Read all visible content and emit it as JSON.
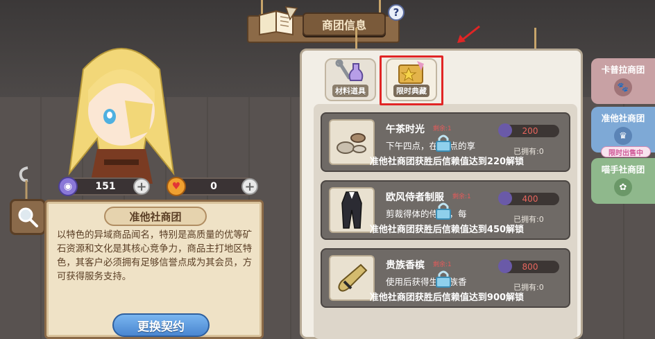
{
  "header": {
    "title": "商团信息",
    "help_label": "?"
  },
  "currencies": [
    {
      "name": "purple-gem",
      "value": "151",
      "plus": "+"
    },
    {
      "name": "heart-token",
      "value": "0",
      "plus": "+"
    }
  ],
  "guild": {
    "name": "准他社商团",
    "description": "以特色的异域商品闻名，特别是高质量的优等矿石资源和文化是其核心竞争力，商品主打地区特色，其客户必须拥有足够信誉点成为其会员，方可获得服务支持。",
    "swap_button": "更换契约"
  },
  "shop_tabs": [
    {
      "label": "材料道具",
      "icon": "potion-wrench-icon",
      "active": false
    },
    {
      "label": "限时典藏",
      "icon": "star-folder-icon",
      "active": true
    }
  ],
  "items": [
    {
      "name": "午茶时光",
      "remaining": "剩余:1",
      "description": "下午四点，在    甜点的享",
      "price": "200",
      "owned": "已拥有:0",
      "lock_text": "准他社商团获胜后信赖值达到220解锁",
      "icon": "tea-set-icon"
    },
    {
      "name": "欧风侍者制服",
      "remaining": "剩余:1",
      "description": "剪裁得体的侍    服，每",
      "price": "400",
      "owned": "已拥有:0",
      "lock_text": "准他社商团获胜后信赖值达到450解锁",
      "icon": "butler-uniform-icon"
    },
    {
      "name": "贵族香槟",
      "remaining": "剩余:1",
      "description": "使用后获得生    贵族香",
      "price": "800",
      "owned": "已拥有:0",
      "lock_text": "准他社商团获胜后信赖值达到900解锁",
      "icon": "champagne-icon"
    }
  ],
  "side_tabs": [
    {
      "label": "卡普拉商团",
      "color": "#c8a1a4",
      "emblem": "dog-emblem-icon"
    },
    {
      "label": "准他社商团",
      "color": "#7ea9d6",
      "emblem": "chef-emblem-icon"
    },
    {
      "label": "喵手社商团",
      "color": "#8fb88c",
      "emblem": "paw-emblem-icon"
    }
  ],
  "limited_badge": "限时出售中",
  "colors": {
    "accent_red": "#e12525",
    "price_red": "#e8665e",
    "swap_blue": "#4a86d0"
  }
}
